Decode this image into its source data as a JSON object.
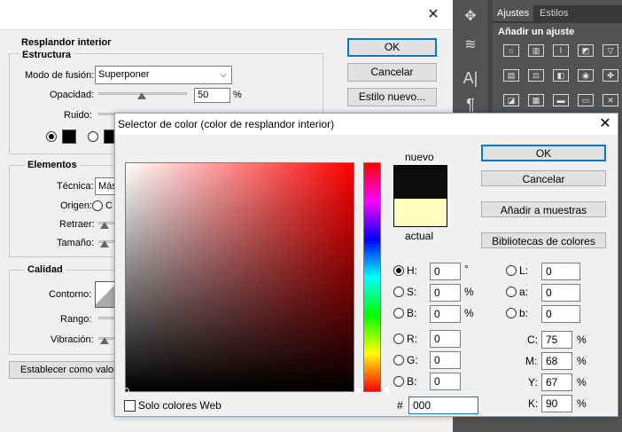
{
  "layer_style": {
    "section_title": "Resplandor interior",
    "estructura": {
      "title": "Estructura",
      "blend_label": "Modo de fusión:",
      "blend_value": "Superponer",
      "opacity_label": "Opacidad:",
      "opacity_value": "50",
      "opacity_unit": "%",
      "noise_label": "Ruido:"
    },
    "elementos": {
      "title": "Elementos",
      "tecnica_label": "Técnica:",
      "tecnica_value": "Más",
      "origen_label": "Origen:",
      "origen_option": "C",
      "retraer_label": "Retraer:",
      "tamano_label": "Tamaño:"
    },
    "calidad": {
      "title": "Calidad",
      "contorno_label": "Contorno:",
      "rango_label": "Rango:",
      "vibracion_label": "Vibración:"
    },
    "default_button": "Establecer como valores",
    "ok_button": "OK",
    "cancel_button": "Cancelar",
    "new_style_button": "Estilo nuevo..."
  },
  "ps_panel": {
    "tabs": [
      "Ajustes",
      "Estilos"
    ],
    "active_tab": "Ajustes",
    "heading": "Añadir un ajuste"
  },
  "picker": {
    "title": "Selector de color (color de resplandor interior)",
    "label_new": "nuevo",
    "label_current": "actual",
    "new_color": "#0b0b0b",
    "current_color": "#ffffbe",
    "ok_button": "OK",
    "cancel_button": "Cancelar",
    "add_swatches_button": "Añadir a muestras",
    "libraries_button": "Bibliotecas de colores",
    "web_only_label": "Solo colores Web",
    "hex_symbol": "#",
    "hex_value": "000",
    "hsb": [
      {
        "label": "H:",
        "value": "0",
        "unit": "°"
      },
      {
        "label": "S:",
        "value": "0",
        "unit": "%"
      },
      {
        "label": "B:",
        "value": "0",
        "unit": "%"
      }
    ],
    "rgb": [
      {
        "label": "R:",
        "value": "0"
      },
      {
        "label": "G:",
        "value": "0"
      },
      {
        "label": "B:",
        "value": "0"
      }
    ],
    "lab": [
      {
        "label": "L:",
        "value": "0"
      },
      {
        "label": "a:",
        "value": "0"
      },
      {
        "label": "b:",
        "value": "0"
      }
    ],
    "cmyk": [
      {
        "label": "C:",
        "value": "75",
        "unit": "%"
      },
      {
        "label": "M:",
        "value": "68",
        "unit": "%"
      },
      {
        "label": "Y:",
        "value": "67",
        "unit": "%"
      },
      {
        "label": "K:",
        "value": "90",
        "unit": "%"
      }
    ]
  }
}
